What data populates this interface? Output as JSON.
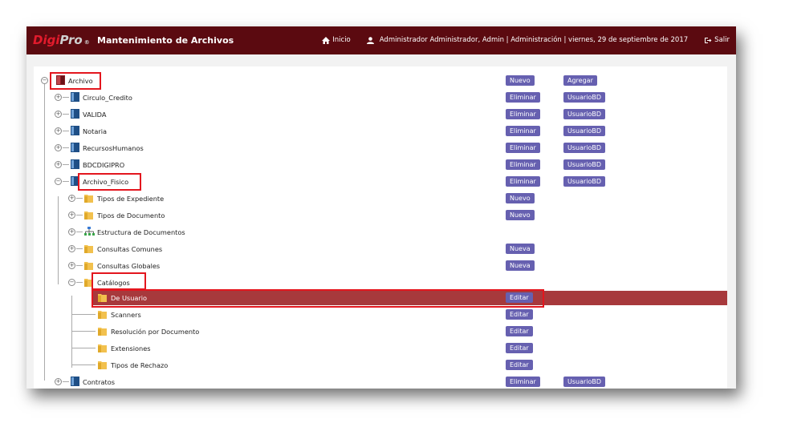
{
  "header": {
    "logo_digi": "Digi",
    "logo_pro": "Pro",
    "logo_reg": "®",
    "app_title": "Mantenimiento de Archivos",
    "home_label": "Inicio",
    "user_info": "Administrador Administrador, Admin | Administración | viernes, 29 de septiembre de 2017",
    "logout_label": "Salir",
    "bar_color": "#5b0a10"
  },
  "tree": {
    "root": {
      "label": "Archivo",
      "btn1": "Nuevo",
      "btn2": "Agregar"
    },
    "databases": [
      {
        "label": "Circulo_Credito",
        "btn1": "Eliminar",
        "btn2": "UsuarioBD"
      },
      {
        "label": "VALIDA",
        "btn1": "Eliminar",
        "btn2": "UsuarioBD"
      },
      {
        "label": "Notaria",
        "btn1": "Eliminar",
        "btn2": "UsuarioBD"
      },
      {
        "label": "RecursosHumanos",
        "btn1": "Eliminar",
        "btn2": "UsuarioBD"
      },
      {
        "label": "BDCDIGIPRO",
        "btn1": "Eliminar",
        "btn2": "UsuarioBD"
      },
      {
        "label": "Archivo_Fisico",
        "btn1": "Eliminar",
        "btn2": "UsuarioBD"
      }
    ],
    "fisico_children": [
      {
        "label": "Tipos de Expediente",
        "btn1": "Nuevo"
      },
      {
        "label": "Tipos de Documento",
        "btn1": "Nuevo"
      },
      {
        "label": "Estructura de Documentos"
      },
      {
        "label": "Consultas Comunes",
        "btn1": "Nueva"
      },
      {
        "label": "Consultas Globales",
        "btn1": "Nueva"
      },
      {
        "label": "Catálogos"
      }
    ],
    "catalogos_children": [
      {
        "label": "De Usuario",
        "btn1": "Editar"
      },
      {
        "label": "Scanners",
        "btn1": "Editar"
      },
      {
        "label": "Resolución por Documento",
        "btn1": "Editar"
      },
      {
        "label": "Extensiones",
        "btn1": "Editar"
      },
      {
        "label": "Tipos de Rechazo",
        "btn1": "Editar"
      }
    ],
    "last": {
      "label": "Contratos",
      "btn1": "Eliminar",
      "btn2": "UsuarioBD"
    }
  }
}
